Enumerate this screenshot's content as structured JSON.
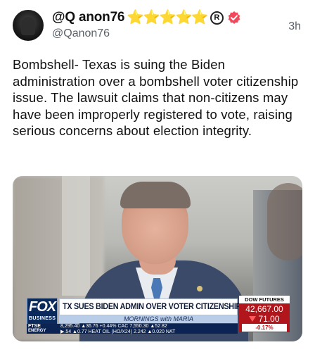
{
  "post": {
    "display_name": "@Q anon76",
    "name_decorations": "⭐⭐⭐⭐⭐",
    "registered_mark": "R",
    "handle": "@Qanon76",
    "time": "3h",
    "body": "Bombshell- Texas is suing the Biden administration over a bombshell voter citizenship issue. The lawsuit claims that non-citizens may have been improperly registered to vote, raising serious concerns about election integrity.",
    "verified_color": "#f2485b",
    "icons": {
      "avatar": "avatar",
      "verified": "verified-badge-icon"
    }
  },
  "media": {
    "logo_top": "FOX",
    "logo_bottom": "BUSINESS",
    "headline": "TX SUES BIDEN ADMIN OVER VOTER CITIZENSHIP",
    "show": "MORNINGS with MARIA",
    "dow_label": "DOW FUTURES",
    "dow_value": "42,667.00",
    "dow_change": "71.00",
    "dow_pct": "-0.17%",
    "ticker_label_1": "FTSE",
    "ticker_label_2": "ENERGY",
    "ticker_row_1": "8,295.40 ▲36.76  +0.44%  CAC  7,550.30 ▲52.82",
    "ticker_row_2": "▶.54  ▲0.77  HEAT OIL (HO/X24) 2.242 ▲0.020  NAT"
  }
}
